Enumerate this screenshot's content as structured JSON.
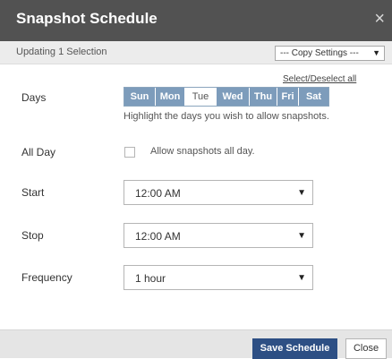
{
  "dialog": {
    "title": "Snapshot Schedule",
    "close_glyph": "×",
    "close_icon": "close-icon"
  },
  "subheader": {
    "label": "Updating 1 Selection",
    "copy_settings": {
      "value": "--- Copy Settings ---",
      "arrow_glyph": "▼"
    }
  },
  "days": {
    "label": "Days",
    "select_all": "Select/Deselect all",
    "items": [
      {
        "label": "Sun",
        "selected": true
      },
      {
        "label": "Mon",
        "selected": true
      },
      {
        "label": "Tue",
        "selected": false
      },
      {
        "label": "Wed",
        "selected": true
      },
      {
        "label": "Thu",
        "selected": true
      },
      {
        "label": "Fri",
        "selected": true
      },
      {
        "label": "Sat",
        "selected": true
      }
    ],
    "hint": "Highlight the days you wish to allow snapshots."
  },
  "all_day": {
    "label": "All Day",
    "checkbox_label": "Allow snapshots all day.",
    "checked": false
  },
  "start": {
    "label": "Start",
    "value": "12:00 AM"
  },
  "stop": {
    "label": "Stop",
    "value": "12:00 AM"
  },
  "frequency": {
    "label": "Frequency",
    "value": "1 hour"
  },
  "select_arrow_glyph": "▼",
  "footer": {
    "save_label": "Save Schedule",
    "close_label": "Close"
  },
  "colors": {
    "titlebar": "#525252",
    "day_selected": "#7d9cbb",
    "primary_button": "#2d4f84"
  }
}
